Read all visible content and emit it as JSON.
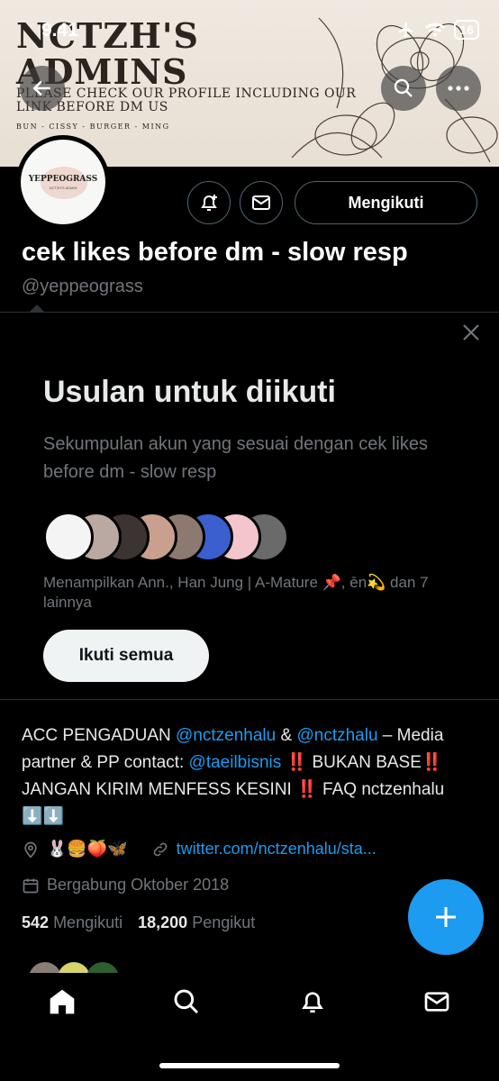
{
  "status_bar": {
    "time": "9.41",
    "battery": "16"
  },
  "banner": {
    "title_line1": "NCTZH'S",
    "title_line2": "ADMINS",
    "subtitle": "PLEASE CHECK OUR PROFILE INCLUDING OUR LINK BEFORE DM US",
    "names": "BUN - CISSY - BURGER - MING"
  },
  "avatar": {
    "line1": "YEPPEOGRASS",
    "line2": "NCTZH'S ADMIN"
  },
  "profile": {
    "follow_label": "Mengikuti",
    "display_name": "cek likes before dm - slow resp",
    "handle": "@yeppeograss"
  },
  "suggestions": {
    "title": "Usulan untuk diikuti",
    "description": "Sekumpulan akun yang sesuai dengan cek likes before dm - slow resp",
    "note": "Menampilkan Ann., Han Jung | A-Mature 📌, ēn💫 dan 7 lainnya",
    "follow_all_label": "Ikuti semua",
    "face_colors": [
      "#f4f4f4",
      "#b9a9a2",
      "#3b3432",
      "#c9a08d",
      "#8c7a70",
      "#3b5fcf",
      "#f2c6cc",
      "#6a6a6a"
    ]
  },
  "bio": {
    "p1": "ACC PENGADUAN ",
    "m1": "@nctzenhalu",
    "p2": " & ",
    "m2": "@nctzhalu",
    "p3": " – Media partner & PP contact: ",
    "m3": "@taeilbisnis",
    "p4": " ‼️ BUKAN BASE‼️ JANGAN KIRIM MENFESS KESINI ‼️ FAQ nctzenhalu ⬇️⬇️",
    "location": "🐰🍔🍑🦋",
    "url": "twitter.com/nctzenhalu/sta...",
    "joined": "Bergabung Oktober 2018",
    "following_count": "542",
    "following_label": "Mengikuti",
    "followers_count": "18,200",
    "followers_label": "Pengikut"
  },
  "colors": {
    "accent": "#1d9bf0",
    "background": "#000000",
    "muted": "#71767b"
  }
}
